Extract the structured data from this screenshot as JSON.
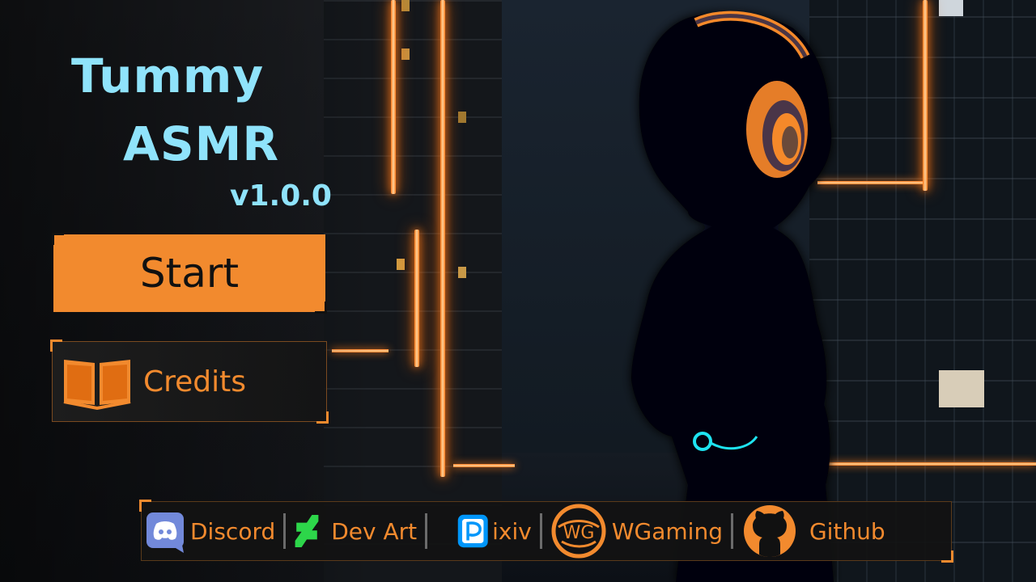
{
  "game": {
    "title_line1": "Tummy",
    "title_line2": "ASMR",
    "version": "v1.0.0"
  },
  "menu": {
    "start_label": "Start",
    "credits_label": "Credits",
    "credits_icon": "open-book-icon"
  },
  "links": [
    {
      "label": "Discord",
      "icon": "discord-icon"
    },
    {
      "label": "Dev Art",
      "icon": "deviantart-icon"
    },
    {
      "label": "ixiv",
      "icon": "pixiv-icon"
    },
    {
      "label": "WGaming",
      "icon": "wgaming-icon"
    },
    {
      "label": "Github",
      "icon": "github-icon"
    }
  ],
  "colors": {
    "accent_orange": "#f28a2e",
    "title_cyan": "#8fe3fb",
    "navel_ring_cyan": "#1ee3f0"
  }
}
